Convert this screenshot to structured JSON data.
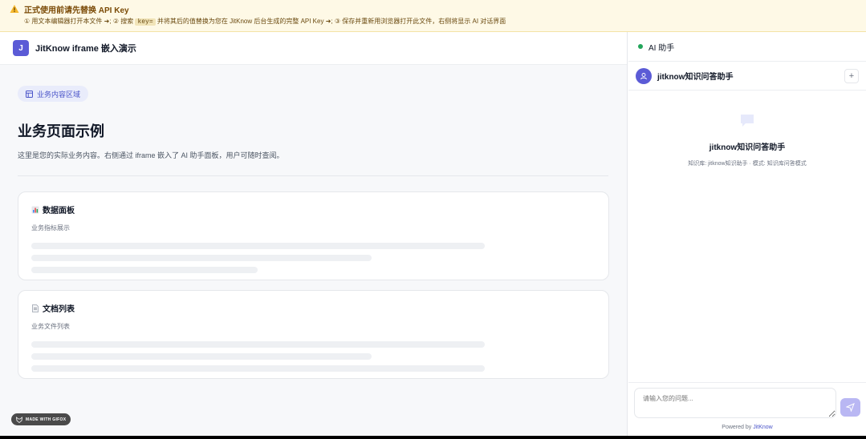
{
  "banner": {
    "title": "正式使用前请先替换 API Key",
    "step1": "① 用文本编辑器打开本文件",
    "step2": "② 搜索",
    "step2_code": "key=",
    "step2_rest": "并将其后的值替换为您在 JitKnow 后台生成的完整 API Key",
    "step3": "③ 保存并重新用浏览器打开此文件，右侧将显示 AI 对话界面",
    "arrow": "➜;"
  },
  "left": {
    "app_title": "JitKnow iframe 嵌入演示",
    "logo_letter": "J",
    "chip_label": "业务内容区域",
    "heading": "业务页面示例",
    "description": "这里是您的实际业务内容。右侧通过 iframe 嵌入了 AI 助手面板，用户可随时查阅。",
    "cards": [
      {
        "title": "数据面板",
        "subtitle": "业务指标展示"
      },
      {
        "title": "文档列表",
        "subtitle": "业务文件列表"
      }
    ]
  },
  "right": {
    "header_title": "AI 助手",
    "agent_name": "jitknow知识问答助手",
    "plus": "+",
    "welcome_title": "jitknow知识问答助手",
    "welcome_meta": "知识库: jitknow知识助手 · 模式: 知识库问答模式",
    "input_placeholder": "请输入您的问题...",
    "powered_prefix": "Powered by ",
    "powered_brand": "JitKnow"
  },
  "watermark": {
    "label": "MADE WITH GIFOX"
  },
  "colors": {
    "accent": "#5b5bd6",
    "banner_bg": "#fef9e6",
    "status_green": "#22a55a"
  }
}
